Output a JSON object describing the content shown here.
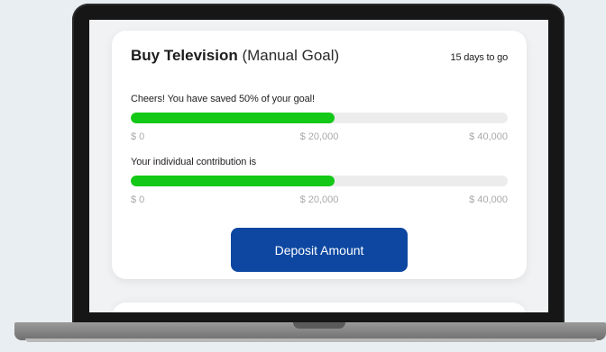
{
  "goal": {
    "name": "Buy Television",
    "type_label": "(Manual Goal)",
    "days_left": "15 days to go",
    "saved_caption": "Cheers! You have saved 50% of your goal!",
    "saved_progress": 0.54,
    "contribution_caption": "Your individual contribution is",
    "contribution_progress": 0.54,
    "scale": {
      "min": "$ 0",
      "mid": "$ 20,000",
      "max": "$ 40,000"
    },
    "deposit_label": "Deposit Amount"
  },
  "colors": {
    "progress_fill": "#13c816",
    "button_bg": "#0d47a1"
  }
}
